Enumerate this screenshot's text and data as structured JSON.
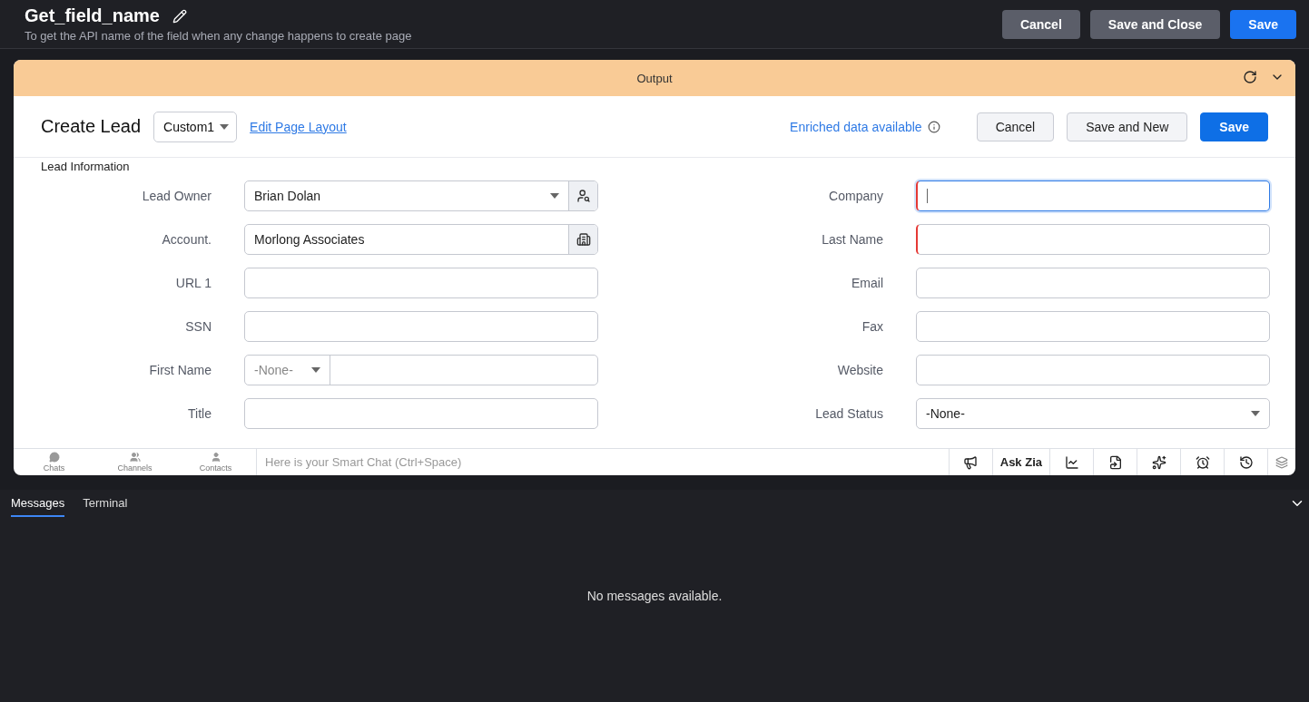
{
  "header": {
    "title": "Get_field_name",
    "subtitle": "To get the API name of the field when any change happens to create page",
    "buttons": [
      {
        "label": "Cancel",
        "kind": "secondary"
      },
      {
        "label": "Save and Close",
        "kind": "secondary"
      },
      {
        "label": "Save",
        "kind": "primary"
      }
    ]
  },
  "output": {
    "title": "Output",
    "form": {
      "title": "Create Lead",
      "layout": "Custom1",
      "layout_link": "Edit Page Layout",
      "enriched": "Enriched data available",
      "buttons": [
        {
          "label": "Cancel",
          "kind": "secondary"
        },
        {
          "label": "Save and New",
          "kind": "secondary"
        },
        {
          "label": "Save",
          "kind": "primary"
        }
      ],
      "section": "Lead Information",
      "left_fields": [
        {
          "label": "Lead Owner",
          "kind": "user_lookup",
          "value": "Brian Dolan"
        },
        {
          "label": "Account.",
          "kind": "account_lookup",
          "value": "Morlong Associates"
        },
        {
          "label": "URL 1",
          "kind": "text"
        },
        {
          "label": "SSN",
          "kind": "text"
        },
        {
          "label": "First Name",
          "kind": "salutation",
          "prefix": "-None-"
        },
        {
          "label": "Title",
          "kind": "text"
        }
      ],
      "right_fields": [
        {
          "label": "Company",
          "kind": "text",
          "mandatory": true,
          "focused": true
        },
        {
          "label": "Last Name",
          "kind": "text",
          "mandatory": true,
          "focused": false
        },
        {
          "label": "Email",
          "kind": "text",
          "mandatory": false,
          "focused": false
        },
        {
          "label": "Fax",
          "kind": "text",
          "mandatory": false,
          "focused": false
        },
        {
          "label": "Website",
          "kind": "text",
          "mandatory": false,
          "focused": false
        },
        {
          "label": "Lead Status",
          "kind": "select",
          "value": "-None-",
          "mandatory": false,
          "focused": false
        }
      ]
    },
    "chatbar": {
      "tabs": [
        "Chats",
        "Channels",
        "Contacts"
      ],
      "placeholder": "Here is your Smart Chat (Ctrl+Space)",
      "ask": "Ask Zia"
    }
  },
  "console": {
    "tabs": [
      {
        "label": "Messages",
        "selected": true
      },
      {
        "label": "Terminal",
        "selected": false
      }
    ],
    "empty": "No messages available."
  }
}
